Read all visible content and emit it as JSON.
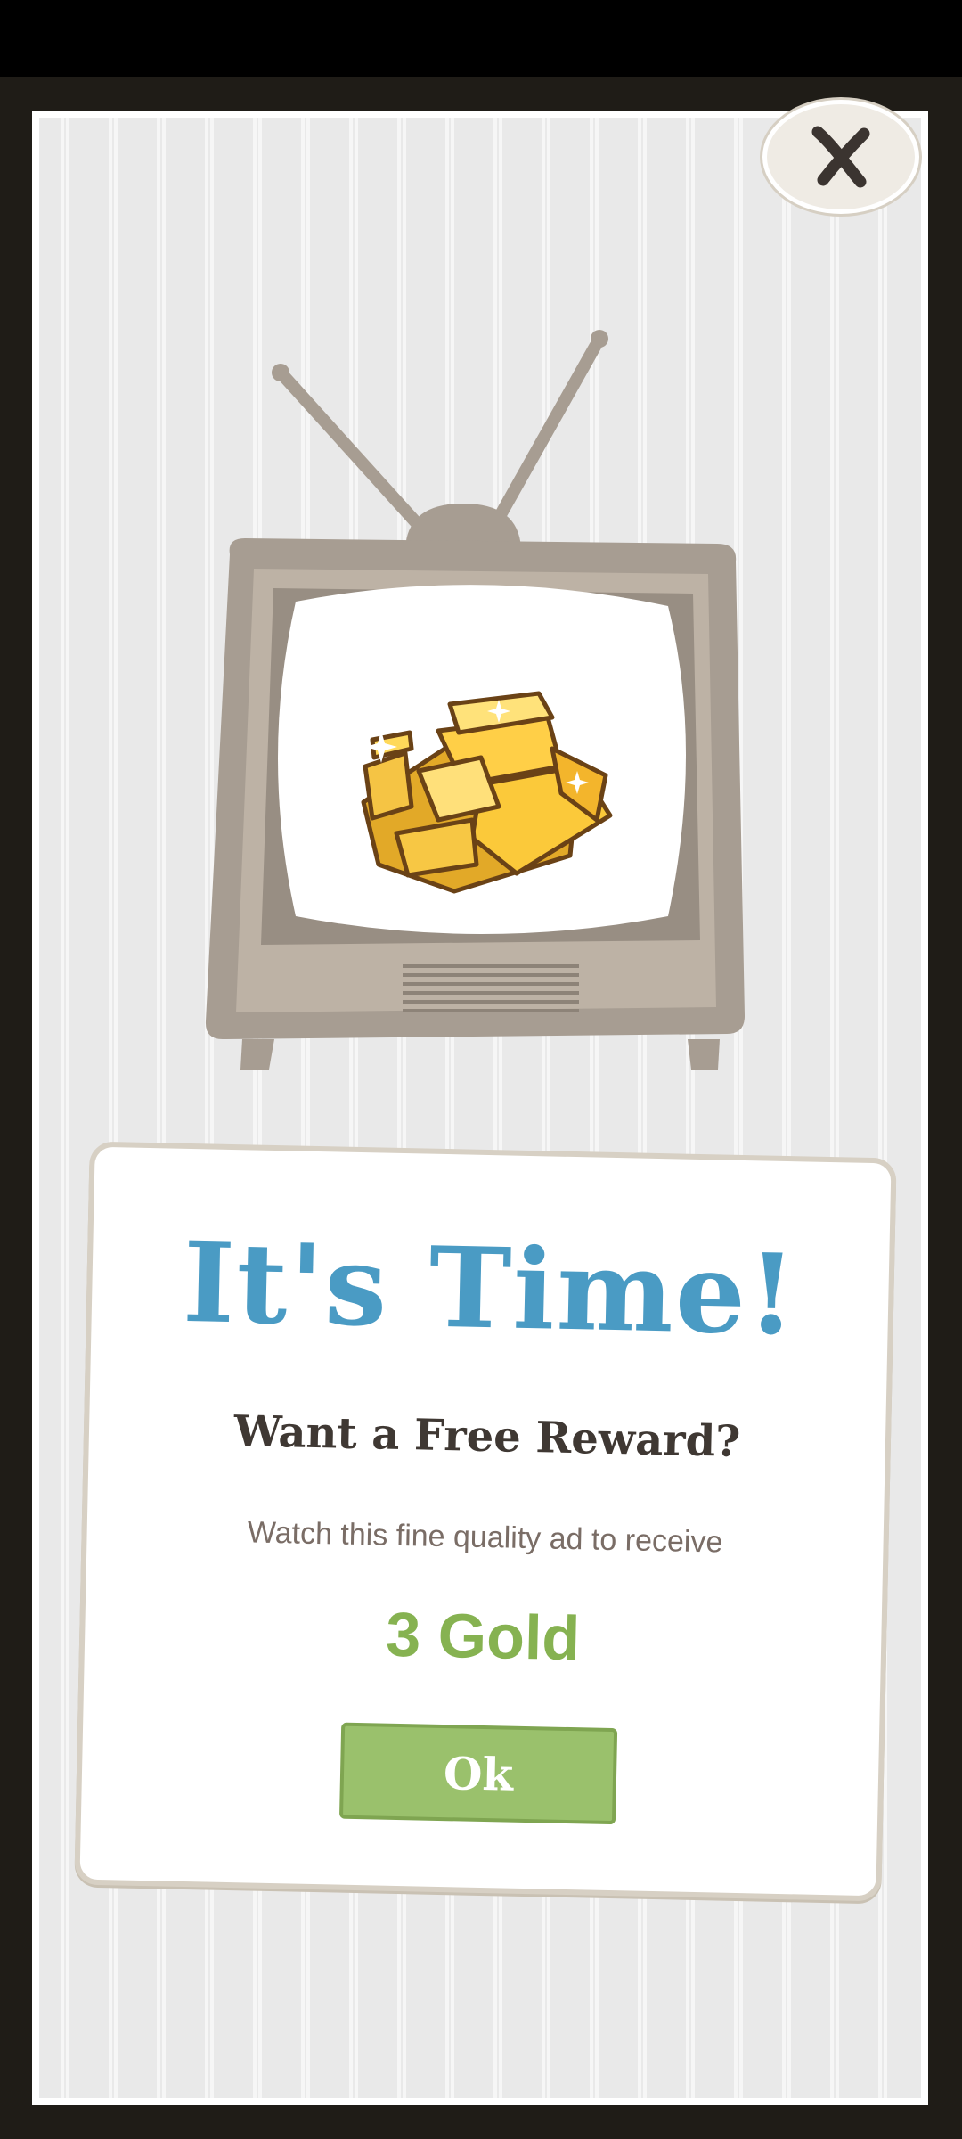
{
  "dialog": {
    "title": "It's Time!",
    "subtitle": "Want a Free Reward?",
    "description": "Watch this fine quality ad to receive",
    "reward": "3 Gold",
    "ok_label": "Ok",
    "close_icon": "close-icon",
    "illustration": "tv-with-gold-icon"
  },
  "colors": {
    "title": "#4a9bc4",
    "reward": "#86b251",
    "button": "#9ac16c",
    "tv_body": "#a79d92",
    "panel": "#ececec"
  }
}
